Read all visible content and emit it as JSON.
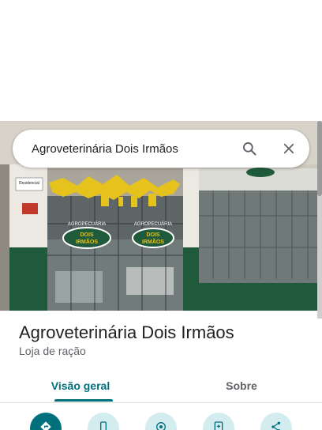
{
  "search": {
    "query": "Agroveterinária Dois Irmãos"
  },
  "photo": {
    "sign_text_1": "AGROPECUÁRIA",
    "sign_text_2": "DOIS",
    "sign_text_3": "IRMÃOS",
    "side_sign": "Residencial"
  },
  "place": {
    "name": "Agroveterinária Dois Irmãos",
    "category": "Loja de ração"
  },
  "tabs": [
    {
      "label": "Visão geral"
    },
    {
      "label": "Sobre"
    }
  ],
  "actions": [
    {
      "icon": "directions-icon"
    },
    {
      "icon": "phone-icon"
    },
    {
      "icon": "location-icon"
    },
    {
      "icon": "save-icon"
    },
    {
      "icon": "share-icon"
    }
  ],
  "colors": {
    "accent": "#00707c",
    "accent_light": "#d3ecef",
    "storefront_green": "#1f5b3a"
  }
}
